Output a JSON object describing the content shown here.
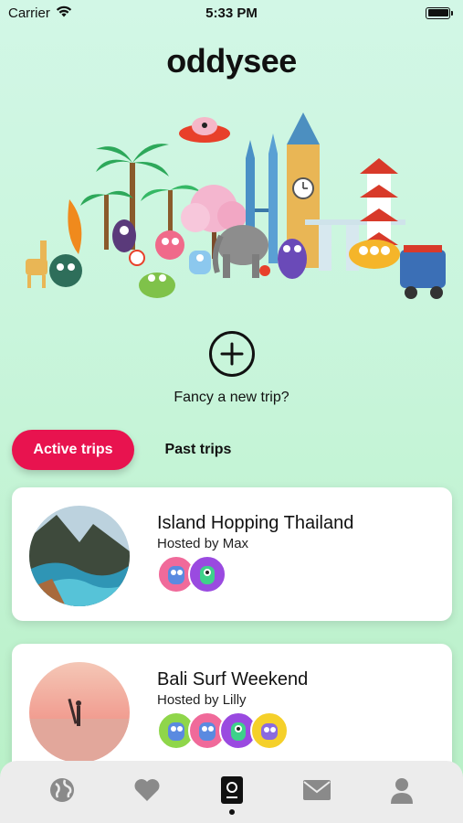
{
  "status_bar": {
    "carrier": "Carrier",
    "time": "5:33 PM",
    "wifi_icon": "wifi-icon",
    "battery_icon": "battery-icon"
  },
  "app": {
    "logo": "oddysee"
  },
  "new_trip": {
    "icon": "plus-circle-icon",
    "label": "Fancy a new trip?"
  },
  "tabs": [
    {
      "label": "Active trips",
      "active": true
    },
    {
      "label": "Past trips",
      "active": false
    }
  ],
  "trips": [
    {
      "title": "Island Hopping Thailand",
      "host": "Hosted by Max",
      "photo": "thailand-coast-photo",
      "members": [
        "pink-monster-avatar",
        "green-monster-avatar"
      ]
    },
    {
      "title": "Bali Surf Weekend",
      "host": "Hosted by Lilly",
      "photo": "surfer-sunset-photo",
      "members": [
        "green-monster-avatar",
        "pink-monster-avatar",
        "purple-monster-avatar",
        "yellow-monster-avatar"
      ]
    }
  ],
  "bottom_nav": {
    "items": [
      "globe-icon",
      "heart-icon",
      "passport-icon",
      "mail-icon",
      "profile-icon"
    ],
    "active": "passport-icon"
  },
  "colors": {
    "accent": "#e8134f",
    "background_top": "#d2f7e6",
    "background_bottom": "#b8f0c6",
    "nav_bg": "#ececec",
    "icon_gray": "#8a8a8a"
  }
}
